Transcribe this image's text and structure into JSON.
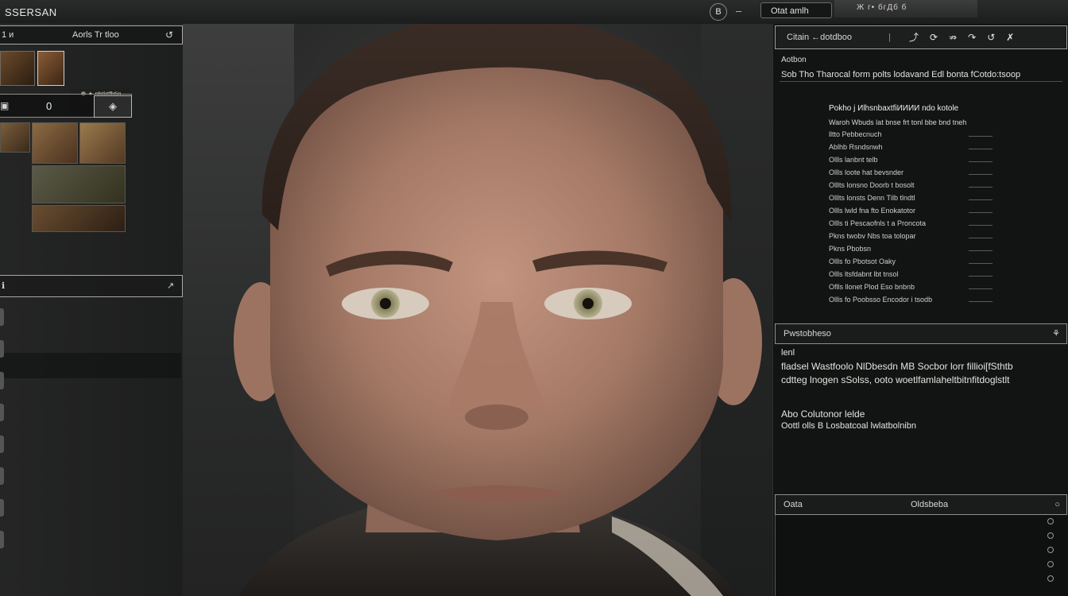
{
  "app": {
    "title": "SSERSAN",
    "top_icon": "B",
    "top_dash": "–",
    "search_value": "Otat amlh",
    "top_strip_text": "Ж г• бгДб б"
  },
  "left_panel": {
    "header_left": "1 и",
    "header_label": "Aorls Tr tloo",
    "header_icon": "↺",
    "thumb_caption": "❁ ✦ pbtirtfhtig",
    "slider": {
      "icon": "▣",
      "value": "0",
      "button_icon": "◈"
    },
    "section2_left": "ℹ",
    "section2_icon": "↗"
  },
  "right_panel": {
    "header_title": "Citain ←dotdboo",
    "header_stub": "|",
    "tools": [
      "⤴",
      "⟳",
      "⇏",
      "↷",
      "↺",
      "✗"
    ],
    "section_label": "Aotbon",
    "description": "Sob Tho Tharocal form polts lodavand Edl bonta fCotdo:tsoop",
    "stats": {
      "head": "Pokho  j  ИlhsnbaxtfiИИИИ  ndo kotole",
      "sub": "Waroh  Wbuds  lat  bnse  frt  tonl bbe  bnd  tneh",
      "rows": [
        "lltto  Pebbecnuch",
        "Ablhb  Rsndsnwh",
        "Ollls  lanbnt  telb",
        "Ollls  loote  hat  bevsnder",
        "Olllts  lonsno  Doorb  t  bosolt",
        "Olllts  lonsts  Denn  Тilb  tlndtl",
        "Ollls  lwld  fna  fto  Enokatotor",
        "Ollls  ti  Pescaofnls  t a  Proncota",
        "Pkns  twobv  Nbs  toa  tolopar",
        "Pkns  Pbobsn",
        "Ollls  fo  Pbotsot  Oaky",
        "Ollls  ltsfdabnt  lbt  tnsol",
        "Oflls  llonet  Plod  Eso  bnbnb",
        "Ollls  fo  Poobsso  Encodor  i  tsodb"
      ]
    },
    "properties": {
      "title": "Pwstobheso",
      "icon": "⚘",
      "label": "lenl",
      "line1": "fladsel Wastfoolo NlDbesdn MB  Socbor lorr fillioi[fSthtb",
      "line2": "cdtteg lnogen sSolss, ooto woetlfamlaheltbitnfitdoglstlt",
      "line3": "Abo  Colutonor lelde",
      "line4": "Oottl olls  B  Losbatcoal  lwlatbolnibn"
    },
    "footer_bar": {
      "left": "Oata",
      "center": "Oldsbeba",
      "icon": "○"
    }
  }
}
